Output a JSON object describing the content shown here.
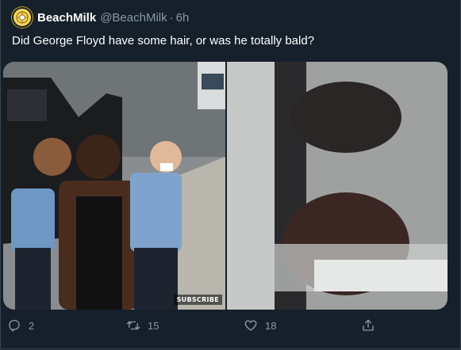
{
  "tweet": {
    "display_name": "BeachMilk",
    "handle": "@BeachMilk",
    "separator": "·",
    "time": "6h",
    "text": "Did George Floyd have some hair, or was he totally bald?",
    "media": {
      "left_watermark": "SUBSCRIBE"
    },
    "actions": {
      "reply_count": "2",
      "retweet_count": "15",
      "like_count": "18"
    }
  },
  "colors": {
    "background": "#15202b",
    "border": "#38444d",
    "text_primary": "#ffffff",
    "text_secondary": "#8899a6"
  },
  "icons": {
    "avatar": "avatar-logo",
    "reply": "reply-icon",
    "retweet": "retweet-icon",
    "like": "heart-icon",
    "share": "share-icon"
  }
}
